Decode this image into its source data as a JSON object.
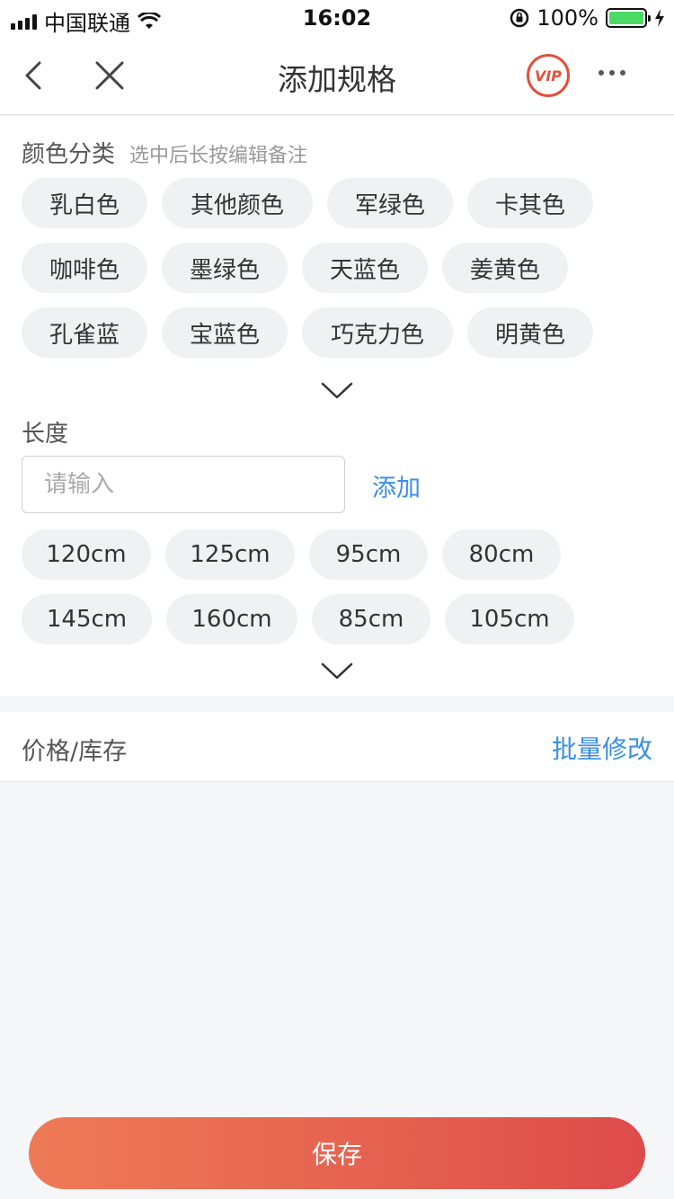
{
  "status_bar": {
    "carrier": "中国联通",
    "time": "16:02",
    "battery": "100%",
    "icons": [
      "signal-icon",
      "wifi-icon",
      "rotation-lock-icon",
      "battery-icon",
      "charging-icon"
    ]
  },
  "nav": {
    "title": "添加规格",
    "vip_label": "VIP",
    "icons": [
      "back-arrow-icon",
      "close-icon",
      "vip-icon",
      "more-icon"
    ],
    "accent_color": "#e2503b"
  },
  "color_section": {
    "title": "颜色分类",
    "hint": "选中后长按编辑备注",
    "chips": [
      "乳白色",
      "其他颜色",
      "军绿色",
      "卡其色",
      "咖啡色",
      "墨绿色",
      "天蓝色",
      "姜黄色",
      "孔雀蓝",
      "宝蓝色",
      "巧克力色",
      "明黄色"
    ]
  },
  "length_section": {
    "title": "长度",
    "input_placeholder": "请输入",
    "input_value": "",
    "add_label": "添加",
    "chips": [
      "120cm",
      "125cm",
      "95cm",
      "80cm",
      "145cm",
      "160cm",
      "85cm",
      "105cm"
    ]
  },
  "price_row": {
    "label": "价格/库存",
    "action": "批量修改"
  },
  "footer": {
    "save_label": "保存"
  },
  "colors": {
    "link": "#3a8ee6",
    "save_gradient_start": "#ee7a56",
    "save_gradient_end": "#dd4b4b",
    "chip_bg": "#f0f1f3",
    "page_bg": "#f5f6f8"
  }
}
